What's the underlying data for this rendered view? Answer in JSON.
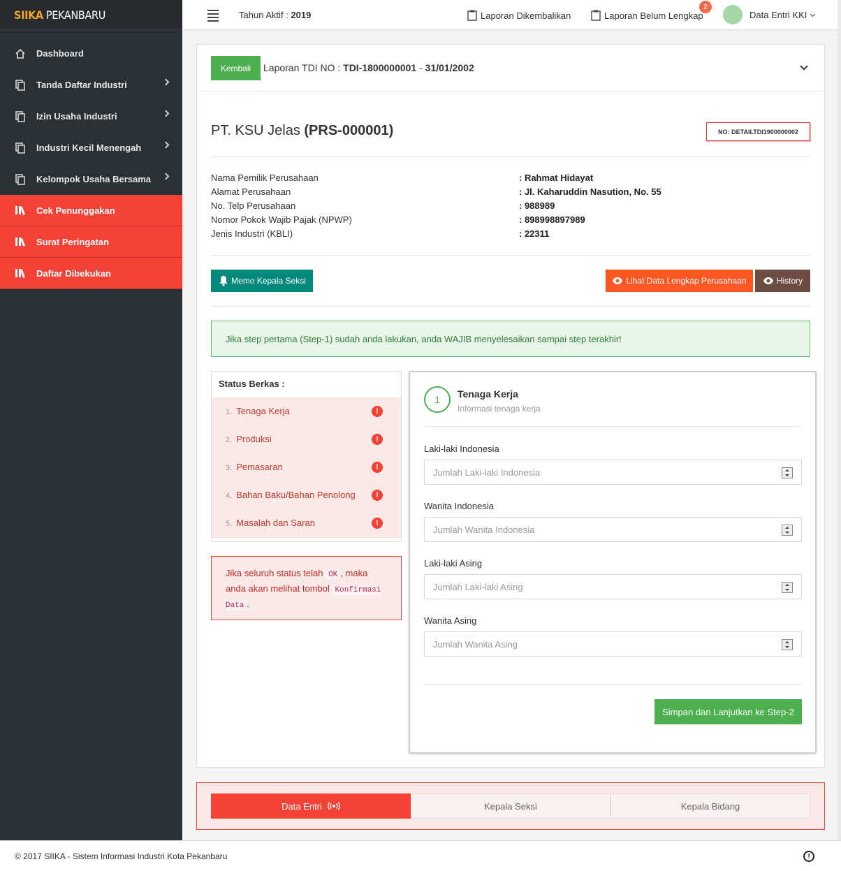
{
  "brand": {
    "bold": "SIIKA",
    "rest": "PEKANBARU"
  },
  "sidebar": {
    "items": [
      {
        "label": "Dashboard",
        "icon": "home-icon"
      },
      {
        "label": "Tanda Daftar Industri",
        "icon": "copy-icon"
      },
      {
        "label": "Izin Usaha Industri",
        "icon": "copy-icon"
      },
      {
        "label": "Industri Kecil Menengah",
        "icon": "copy-icon"
      },
      {
        "label": "Kelompok Usaha Bersama",
        "icon": "copy-icon"
      },
      {
        "label": "Cek Penunggakan",
        "icon": "library-icon"
      },
      {
        "label": "Surat Peringatan",
        "icon": "library-icon"
      },
      {
        "label": "Daftar Dibekukan",
        "icon": "library-icon"
      }
    ]
  },
  "topbar": {
    "tahun_label": "Tahun Aktif :",
    "tahun_value": "2019",
    "laporan_dikembalikan": "Laporan Dikembalikan",
    "laporan_belum": "Laporan Belum Lengkap",
    "laporan_belum_badge": "2",
    "user": "Data Entri KKI"
  },
  "card": {
    "back_label": "Kembali",
    "header_prefix": "Laporan TDI NO :",
    "header_no": "TDI-1800000001",
    "header_sep": "-",
    "header_date": "31/01/2002",
    "company_name": "PT. KSU Jelas",
    "company_code": "(PRS-000001)",
    "detail_no": "NO: DETAILTDI1900000002",
    "info": [
      {
        "label": "Nama Pemilik Perusahaan",
        "value": ": Rahmat Hidayat"
      },
      {
        "label": "Alamat Perusahaan",
        "value": ": Jl. Kaharuddin Nasution, No. 55"
      },
      {
        "label": "No. Telp Perusahaan",
        "value": ": 988989"
      },
      {
        "label": "Nomor Pokok Wajib Pajak (NPWP)",
        "value": ": 898998897989"
      },
      {
        "label": "Jenis Industri (KBLI)",
        "value": ": 22311"
      }
    ],
    "memo_label": "Memo Kepala Seksi",
    "lihat_label": "Lihat Data Lengkap Perusahaan",
    "history_label": "History",
    "alert": "Jika step pertama (Step-1) sudah anda lakukan, anda WAJIB menyelesaikan sampai step terakhir!",
    "status_title": "Status Berkas :",
    "steps": [
      {
        "n": "1.",
        "label": "Tenaga Kerja"
      },
      {
        "n": "2.",
        "label": "Produksi"
      },
      {
        "n": "3.",
        "label": "Pemasaran"
      },
      {
        "n": "4.",
        "label": "Bahan Baku/Bahan Penolong"
      },
      {
        "n": "5.",
        "label": "Masalah dan Saran"
      }
    ],
    "note_1": "Jika seluruh status telah",
    "note_ok": "OK",
    "note_2": ", maka anda akan melihat tombol",
    "note_btn": "Konfirmasi Data",
    "note_3": ".",
    "form": {
      "step_no": "1",
      "title": "Tenaga Kerja",
      "subtitle": "Informasi tenaga kerja",
      "fields": [
        {
          "label": "Laki-laki Indonesia",
          "placeholder": "Jumlah Laki-laki Indonesia"
        },
        {
          "label": "Wanita Indonesia",
          "placeholder": "Jumlah Wanita Indonesia"
        },
        {
          "label": "Laki-laki Asing",
          "placeholder": "Jumlah Laki-laki Asing"
        },
        {
          "label": "Wanita Asing",
          "placeholder": "Jumlah Wanita Asing"
        }
      ],
      "submit": "Simpan dan Lanjutkan ke Step-2"
    }
  },
  "workflow": {
    "tabs": [
      "Data Entri",
      "Kepala Seksi",
      "Kepala Bidang"
    ]
  },
  "footer": {
    "text": "© 2017 SIIKA - Sistem Informasi Industri Kota Pekanbaru"
  },
  "colors": {
    "red": "#f44336",
    "green": "#4caf50",
    "teal": "#00897b",
    "orange": "#ff5722",
    "brown": "#6d4c41",
    "sidebar": "#2b3034"
  }
}
